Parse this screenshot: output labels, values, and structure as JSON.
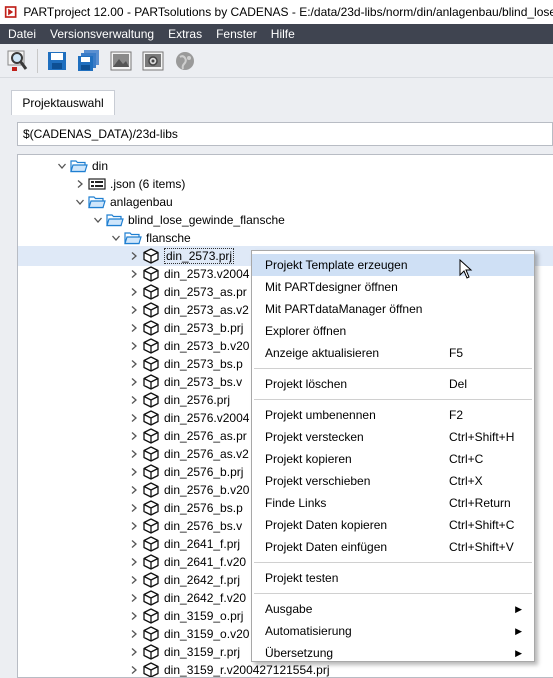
{
  "window": {
    "title": "PARTproject 12.00 - PARTsolutions by CADENAS - E:/data/23d-libs/norm/din/anlagenbau/blind_lose_gewinde_flansche"
  },
  "menubar": {
    "items": [
      "Datei",
      "Versionsverwaltung",
      "Extras",
      "Fenster",
      "Hilfe"
    ]
  },
  "toolbar": {
    "buttons": [
      "search-icon",
      "save-icon",
      "save-all-icon",
      "image-icon",
      "image-settings-icon",
      "globe-icon"
    ]
  },
  "tabs": [
    {
      "label": "Projektauswahl",
      "active": true
    }
  ],
  "path": {
    "value": "$(CADENAS_DATA)/23d-libs"
  },
  "tree": {
    "rows": [
      {
        "label": "din",
        "type": "folder-open",
        "level": 1,
        "expanded": true
      },
      {
        "label": ".json (6 items)",
        "type": "json",
        "level": 2,
        "expanded": false
      },
      {
        "label": "anlagenbau",
        "type": "folder-open",
        "level": 2,
        "expanded": true
      },
      {
        "label": "blind_lose_gewinde_flansche",
        "type": "folder-open",
        "level": 3,
        "expanded": true
      },
      {
        "label": "flansche",
        "type": "folder-open",
        "level": 4,
        "expanded": true
      },
      {
        "label": "din_2573.prj",
        "type": "part",
        "level": 5,
        "selected": true
      },
      {
        "label": "din_2573.v2004",
        "type": "part",
        "level": 5
      },
      {
        "label": "din_2573_as.pr",
        "type": "part",
        "level": 5
      },
      {
        "label": "din_2573_as.v2",
        "type": "part",
        "level": 5
      },
      {
        "label": "din_2573_b.prj",
        "type": "part",
        "level": 5
      },
      {
        "label": "din_2573_b.v20",
        "type": "part",
        "level": 5
      },
      {
        "label": "din_2573_bs.p",
        "type": "part",
        "level": 5
      },
      {
        "label": "din_2573_bs.v",
        "type": "part",
        "level": 5
      },
      {
        "label": "din_2576.prj",
        "type": "part",
        "level": 5
      },
      {
        "label": "din_2576.v2004",
        "type": "part",
        "level": 5
      },
      {
        "label": "din_2576_as.pr",
        "type": "part",
        "level": 5
      },
      {
        "label": "din_2576_as.v2",
        "type": "part",
        "level": 5
      },
      {
        "label": "din_2576_b.prj",
        "type": "part",
        "level": 5
      },
      {
        "label": "din_2576_b.v20",
        "type": "part",
        "level": 5
      },
      {
        "label": "din_2576_bs.p",
        "type": "part",
        "level": 5
      },
      {
        "label": "din_2576_bs.v",
        "type": "part",
        "level": 5
      },
      {
        "label": "din_2641_f.prj",
        "type": "part",
        "level": 5
      },
      {
        "label": "din_2641_f.v20",
        "type": "part",
        "level": 5
      },
      {
        "label": "din_2642_f.prj",
        "type": "part",
        "level": 5
      },
      {
        "label": "din_2642_f.v20",
        "type": "part",
        "level": 5
      },
      {
        "label": "din_3159_o.prj",
        "type": "part",
        "level": 5
      },
      {
        "label": "din_3159_o.v20",
        "type": "part",
        "level": 5
      },
      {
        "label": "din_3159_r.prj",
        "type": "part",
        "level": 5
      },
      {
        "label": "din_3159_r.v200427121554.prj",
        "type": "part",
        "level": 5
      }
    ]
  },
  "context_menu": {
    "groups": [
      [
        {
          "label": "Projekt Template erzeugen",
          "shortcut": "",
          "highlighted": true
        },
        {
          "label": "Mit PARTdesigner öffnen",
          "shortcut": ""
        },
        {
          "label": "Mit PARTdataManager öffnen",
          "shortcut": ""
        },
        {
          "label": "Explorer öffnen",
          "shortcut": ""
        },
        {
          "label": "Anzeige aktualisieren",
          "shortcut": "F5"
        }
      ],
      [
        {
          "label": "Projekt löschen",
          "shortcut": "Del"
        }
      ],
      [
        {
          "label": "Projekt umbenennen",
          "shortcut": "F2"
        },
        {
          "label": "Projekt verstecken",
          "shortcut": "Ctrl+Shift+H"
        },
        {
          "label": "Projekt kopieren",
          "shortcut": "Ctrl+C"
        },
        {
          "label": "Projekt verschieben",
          "shortcut": "Ctrl+X"
        },
        {
          "label": "Finde Links",
          "shortcut": "Ctrl+Return"
        },
        {
          "label": "Projekt Daten kopieren",
          "shortcut": "Ctrl+Shift+C"
        },
        {
          "label": "Projekt Daten einfügen",
          "shortcut": "Ctrl+Shift+V"
        }
      ],
      [
        {
          "label": "Projekt testen",
          "shortcut": ""
        }
      ],
      [
        {
          "label": "Ausgabe",
          "shortcut": "",
          "submenu": true
        },
        {
          "label": "Automatisierung",
          "shortcut": "",
          "submenu": true
        },
        {
          "label": "Übersetzung",
          "shortcut": "",
          "submenu": true
        }
      ]
    ]
  },
  "colors": {
    "menubar_bg": "#3f4450",
    "selection_bg": "#dfe9f7",
    "menu_highlight": "#cfe0f5",
    "folder": "#1f7fd1"
  }
}
